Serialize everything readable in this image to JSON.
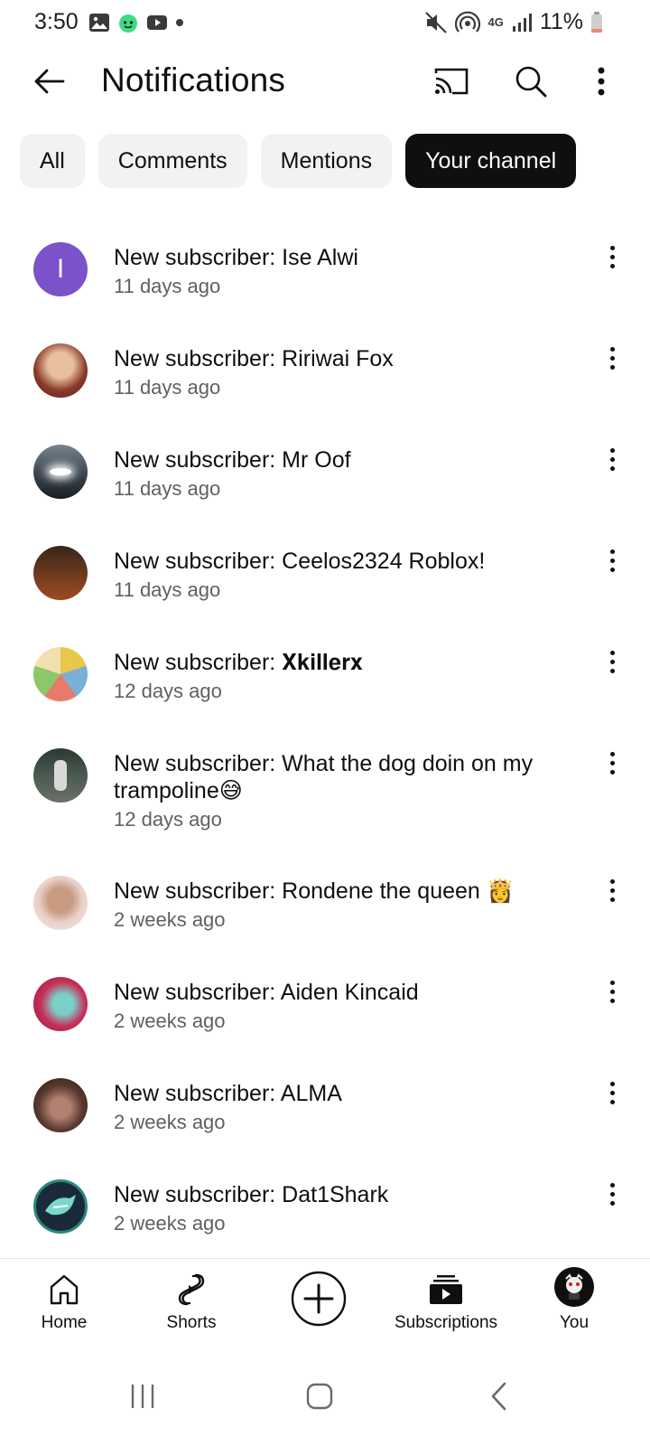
{
  "status_bar": {
    "time": "3:50",
    "battery": "11%",
    "network": "4G"
  },
  "header": {
    "title": "Notifications"
  },
  "chips": [
    {
      "label": "All",
      "active": false
    },
    {
      "label": "Comments",
      "active": false
    },
    {
      "label": "Mentions",
      "active": false
    },
    {
      "label": "Your channel",
      "active": true
    }
  ],
  "notifications": [
    {
      "title": "New subscriber: Ise Alwi",
      "time": "11 days ago",
      "avatar_letter": "I",
      "avatar_color": "#7b52c9"
    },
    {
      "title": "New subscriber: Ririwai Fox",
      "time": "11 days ago",
      "avatar_color": "#8a3a2a"
    },
    {
      "title": "New subscriber: Mr Oof",
      "time": "11 days ago",
      "avatar_color": "#3a4450"
    },
    {
      "title": "New subscriber: Ceelos2324 Roblox!",
      "time": "11 days ago",
      "avatar_color": "#6a3a1e"
    },
    {
      "title": "New subscriber: 𝐗𝐤𝐢𝐥𝐥𝐞𝐫𝐱",
      "time": "12 days ago",
      "avatar_color": "#e8c84a"
    },
    {
      "title": "New subscriber: What the dog doin on my trampoline😅",
      "time": "12 days ago",
      "avatar_color": "#4a5a50"
    },
    {
      "title": "New subscriber: Rondene the queen 👸",
      "time": "2 weeks ago",
      "avatar_color": "#d9b8a8"
    },
    {
      "title": "New subscriber: Aiden Kincaid",
      "time": "2 weeks ago",
      "avatar_color": "#c8305a"
    },
    {
      "title": "New subscriber: ALMA",
      "time": "2 weeks ago",
      "avatar_color": "#5a3a30"
    },
    {
      "title": "New subscriber: Dat1Shark",
      "time": "2 weeks ago",
      "avatar_color": "#1a3a50"
    }
  ],
  "bottom_nav": [
    {
      "label": "Home",
      "icon": "home-icon"
    },
    {
      "label": "Shorts",
      "icon": "shorts-icon"
    },
    {
      "label": "",
      "icon": "create-icon"
    },
    {
      "label": "Subscriptions",
      "icon": "subscriptions-icon"
    },
    {
      "label": "You",
      "icon": "avatar"
    }
  ]
}
